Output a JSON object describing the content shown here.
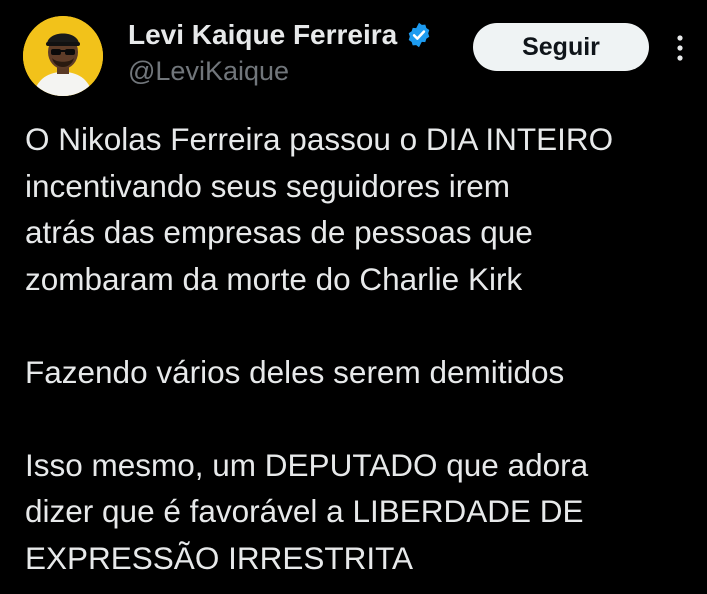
{
  "author": {
    "display_name": "Levi Kaique Ferreira",
    "handle": "@LeviKaique",
    "verified": true,
    "avatar_icon": "profile-photo",
    "avatar_bg": "#f2c21a"
  },
  "actions": {
    "follow_label": "Seguir",
    "more_icon": "more-vertical-icon"
  },
  "tweet": {
    "paragraph_1": [
      "O Nikolas Ferreira passou o DIA INTEIRO",
      "incentivando seus seguidores irem",
      "atrás das empresas de pessoas que",
      "zombaram da morte do Charlie Kirk"
    ],
    "paragraph_2": [
      "Fazendo vários deles serem demitidos"
    ],
    "paragraph_3": [
      "Isso mesmo, um DEPUTADO que adora",
      "dizer que é favorável a LIBERDADE DE",
      "EXPRESSÃO IRRESTRITA"
    ]
  },
  "colors": {
    "background": "#000000",
    "text_primary": "#e7e9ea",
    "text_secondary": "#71767b",
    "verified_blue": "#1d9bf0",
    "follow_bg": "#eff3f4",
    "follow_text": "#0f1419"
  }
}
